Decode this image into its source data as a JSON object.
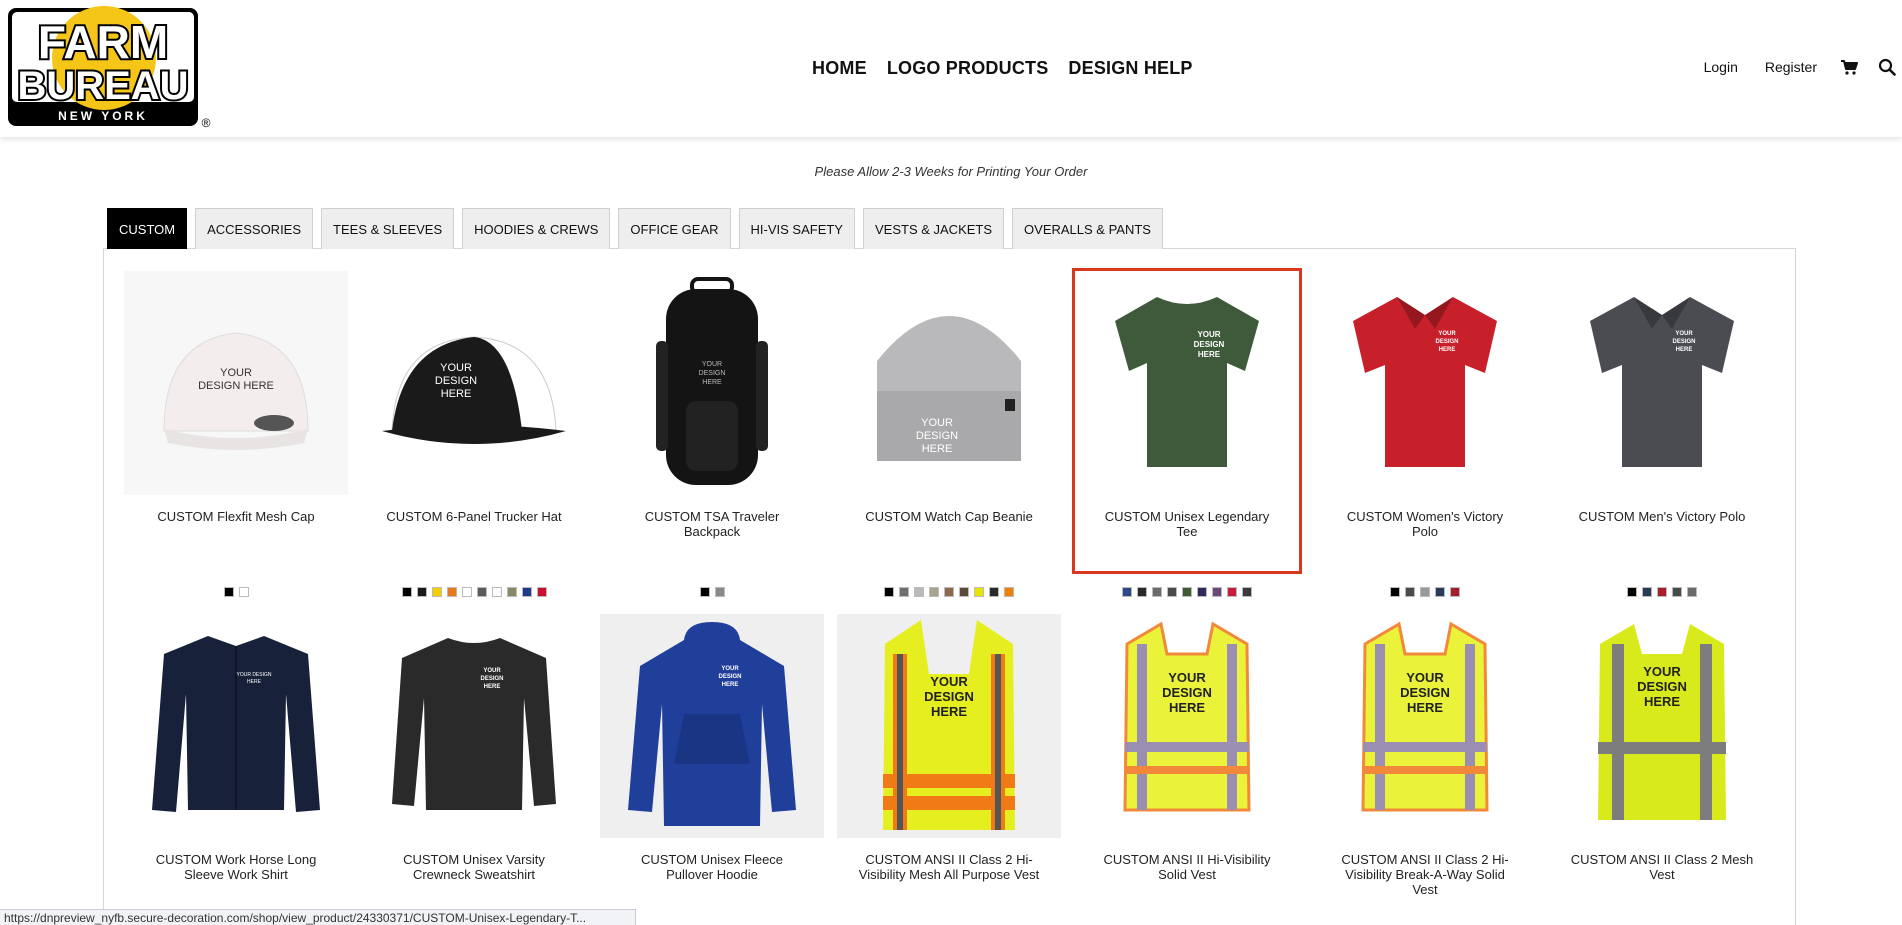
{
  "brand": {
    "logo_line1": "FARM",
    "logo_line2": "BUREAU",
    "logo_line3": "NEW YORK",
    "registered_mark": "®",
    "colors": {
      "black": "#000000",
      "yellow": "#f5c518"
    }
  },
  "main_nav": [
    "HOME",
    "LOGO PRODUCTS",
    "DESIGN HELP"
  ],
  "util_nav": {
    "login": "Login",
    "register": "Register",
    "cart_icon": "cart-icon",
    "search_icon": "search-icon"
  },
  "notice": "Please Allow 2-3 Weeks for Printing Your Order",
  "tabs": [
    {
      "label": "CUSTOM",
      "active": true
    },
    {
      "label": "ACCESSORIES",
      "active": false
    },
    {
      "label": "TEES & SLEEVES",
      "active": false
    },
    {
      "label": "HOODIES & CREWS",
      "active": false
    },
    {
      "label": "OFFICE GEAR",
      "active": false
    },
    {
      "label": "HI-VIS SAFETY",
      "active": false
    },
    {
      "label": "VESTS & JACKETS",
      "active": false
    },
    {
      "label": "OVERALLS & PANTS",
      "active": false
    }
  ],
  "products": [
    {
      "name": "CUSTOM Flexfit Mesh Cap",
      "image_kind": "cap",
      "image_colors": [
        "#f3eded",
        "#ffffff"
      ],
      "bg": "#f7f7f7",
      "print_text": [
        "YOUR",
        "DESIGN HERE"
      ],
      "swatches": [
        "#000000",
        "#ffffff"
      ],
      "selected": false
    },
    {
      "name": "CUSTOM 6-Panel Trucker Hat",
      "image_kind": "trucker",
      "image_colors": [
        "#1a1a1a",
        "#ffffff"
      ],
      "bg": "#ffffff",
      "print_text": [
        "YOUR",
        "DESIGN",
        "HERE"
      ],
      "swatches": [
        "#000000",
        "#1a1a1a",
        "#f4d000",
        "#e87a1a",
        "#ffffff",
        "#5a5a5a",
        "#ffffff",
        "#8a8a6a",
        "#1e3a8a",
        "#c8102e"
      ],
      "selected": false
    },
    {
      "name": "CUSTOM TSA Traveler Backpack",
      "image_kind": "backpack",
      "image_colors": [
        "#141414"
      ],
      "bg": "#ffffff",
      "print_text": [
        "YOUR",
        "DESIGN",
        "HERE"
      ],
      "swatches": [
        "#000000",
        "#8a8a8a"
      ],
      "selected": false
    },
    {
      "name": "CUSTOM Watch Cap Beanie",
      "image_kind": "beanie",
      "image_colors": [
        "#b9b9bb"
      ],
      "bg": "#ffffff",
      "print_text": [
        "YOUR",
        "DESIGN",
        "HERE"
      ],
      "swatches": [
        "#000000",
        "#6f6f6f",
        "#b9b9b9",
        "#a9a393",
        "#8b6b4a",
        "#5a4a36",
        "#e9e300",
        "#2a2a2a",
        "#f07f09"
      ],
      "selected": false
    },
    {
      "name": "CUSTOM Unisex Legendary Tee",
      "image_kind": "tee",
      "image_colors": [
        "#3f5a3a"
      ],
      "bg": "#ffffff",
      "print_text": [
        "YOUR",
        "DESIGN",
        "HERE"
      ],
      "swatches": [
        "#2c4a8a",
        "#2a2a2a",
        "#6a6a6a",
        "#4a4a4a",
        "#3f5a3a",
        "#2e2a5a",
        "#6a4a7a",
        "#c81d3a",
        "#3a3a3a"
      ],
      "selected": true
    },
    {
      "name": "CUSTOM Women's Victory Polo",
      "image_kind": "polo",
      "image_colors": [
        "#c8202a"
      ],
      "bg": "#ffffff",
      "print_text": [
        "YOUR",
        "DESIGN",
        "HERE"
      ],
      "swatches": [
        "#000000",
        "#4a4a4a",
        "#9a9a9a",
        "#2a3a5a",
        "#a81d2a"
      ],
      "selected": false
    },
    {
      "name": "CUSTOM Men's Victory Polo",
      "image_kind": "polo",
      "image_colors": [
        "#4a4c52"
      ],
      "bg": "#ffffff",
      "print_text": [
        "YOUR",
        "DESIGN",
        "HERE"
      ],
      "swatches": [
        "#000000",
        "#2a3a5a",
        "#a81d2a",
        "#4a4a4a",
        "#6a6a6a"
      ],
      "selected": false
    },
    {
      "name": "CUSTOM Work Horse Long Sleeve Work Shirt",
      "image_kind": "workshirt",
      "image_colors": [
        "#17223a"
      ],
      "bg": "#ffffff",
      "print_text": [
        "YOUR DESIGN",
        "HERE"
      ],
      "swatches": [],
      "selected": false
    },
    {
      "name": "CUSTOM Unisex Varsity Crewneck Sweatshirt",
      "image_kind": "crewneck",
      "image_colors": [
        "#2a2a2a"
      ],
      "bg": "#ffffff",
      "print_text": [
        "YOUR",
        "DESIGN",
        "HERE"
      ],
      "swatches": [],
      "selected": false
    },
    {
      "name": "CUSTOM Unisex Fleece Pullover Hoodie",
      "image_kind": "hoodie",
      "image_colors": [
        "#1f3f9a"
      ],
      "bg": "#efefef",
      "print_text": [
        "YOUR",
        "DESIGN",
        "HERE"
      ],
      "swatches": [],
      "selected": false
    },
    {
      "name": "CUSTOM ANSI II Class 2 Hi-Visibility Mesh All Purpose Vest",
      "image_kind": "vest-orange",
      "image_colors": [
        "#e5ee1f",
        "#f07a16",
        "#555555"
      ],
      "bg": "#efefef",
      "print_text": [
        "YOUR",
        "DESIGN",
        "HERE"
      ],
      "swatches": [],
      "selected": false
    },
    {
      "name": "CUSTOM ANSI II Hi-Visibility Solid Vest",
      "image_kind": "vest-solid",
      "image_colors": [
        "#eaf23a",
        "#f2893a",
        "#9a8fb2"
      ],
      "bg": "#ffffff",
      "print_text": [
        "YOUR",
        "DESIGN",
        "HERE"
      ],
      "swatches": [],
      "selected": false
    },
    {
      "name": "CUSTOM ANSI II Class 2 Hi-Visibility Break-A-Way Solid Vest",
      "image_kind": "vest-solid",
      "image_colors": [
        "#eaf23a",
        "#f2893a",
        "#9a8fb2"
      ],
      "bg": "#ffffff",
      "print_text": [
        "YOUR",
        "DESIGN",
        "HERE"
      ],
      "swatches": [],
      "selected": false
    },
    {
      "name": "CUSTOM ANSI II Class 2 Mesh Vest",
      "image_kind": "vest-mesh",
      "image_colors": [
        "#d9ea1c",
        "#7d7d7d"
      ],
      "bg": "#ffffff",
      "print_text": [
        "YOUR",
        "DESIGN",
        "HERE"
      ],
      "swatches": [],
      "selected": false
    }
  ],
  "status_url": "https://dnpreview_nyfb.secure-decoration.com/shop/view_product/24330371/CUSTOM-Unisex-Legendary-T..."
}
